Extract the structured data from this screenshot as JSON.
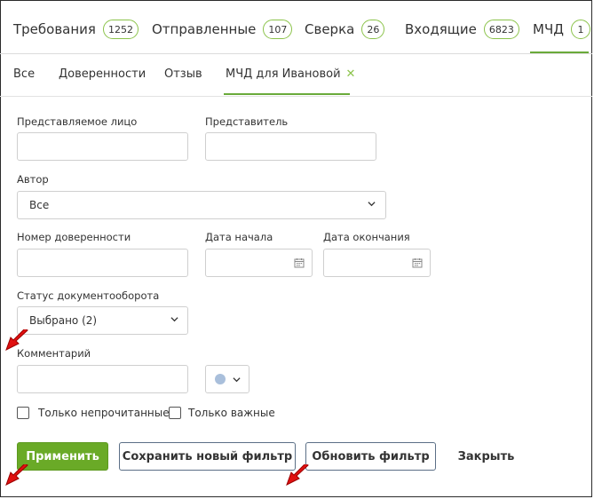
{
  "tabs": [
    {
      "label": "Требования",
      "count": "1252"
    },
    {
      "label": "Отправленные",
      "count": "107"
    },
    {
      "label": "Сверка",
      "count": "26"
    },
    {
      "label": "Входящие",
      "count": "6823"
    },
    {
      "label": "МЧД",
      "count": "1"
    }
  ],
  "subtabs": [
    {
      "label": "Все"
    },
    {
      "label": "Доверенности"
    },
    {
      "label": "Отзыв"
    },
    {
      "label": "МЧД для Ивановой"
    }
  ],
  "form": {
    "represented_label": "Представляемое лицо",
    "represented_value": "",
    "representative_label": "Представитель",
    "representative_value": "",
    "author_label": "Автор",
    "author_value": "Все",
    "poa_number_label": "Номер доверенности",
    "poa_number_value": "",
    "start_date_label": "Дата начала",
    "end_date_label": "Дата окончания",
    "status_label": "Статус документооборота",
    "status_value": "Выбрано (2)",
    "comment_label": "Комментарий",
    "comment_value": "",
    "color_dot": "#a9bfdb",
    "unread_label": "Только непрочитанные",
    "important_label": "Только важные"
  },
  "buttons": {
    "apply": "Применить",
    "save_new": "Сохранить новый фильтр",
    "update": "Обновить фильтр",
    "close": "Закрыть"
  },
  "colors": {
    "accent": "#6aaa27",
    "badge_border": "#8bc34a",
    "arrow": "#e01010"
  }
}
